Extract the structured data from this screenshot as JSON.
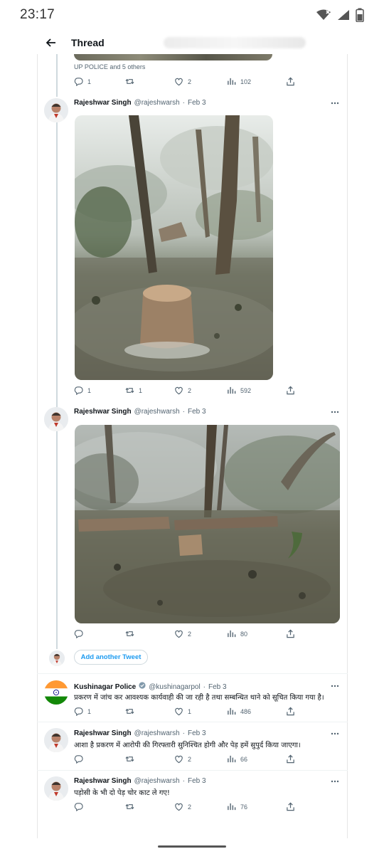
{
  "status_bar": {
    "time": "23:17"
  },
  "header": {
    "title": "Thread"
  },
  "previous_tweet": {
    "context": "UP POLICE and 5 others",
    "replies": "1",
    "retweets": "",
    "likes": "2",
    "views": "102"
  },
  "tweets": [
    {
      "name": "Rajeshwar Singh",
      "handle": "@rajeshwarsh",
      "sep": "·",
      "date": "Feb 3",
      "replies": "1",
      "retweets": "1",
      "likes": "2",
      "views": "592"
    },
    {
      "name": "Rajeshwar Singh",
      "handle": "@rajeshwarsh",
      "sep": "·",
      "date": "Feb 3",
      "replies": "",
      "retweets": "",
      "likes": "2",
      "views": "80"
    }
  ],
  "compose": {
    "add_label": "Add another Tweet"
  },
  "replies": [
    {
      "name": "Kushinagar Police",
      "handle": "@kushinagarpol",
      "sep": "·",
      "date": "Feb 3",
      "text": "प्रकरण में जांच कर आवश्यक कार्यवाही की जा रही है तथा सम्बन्धित थाने को सूचित किया गया है।",
      "replies": "1",
      "retweets": "",
      "likes": "1",
      "views": "486"
    },
    {
      "name": "Rajeshwar Singh",
      "handle": "@rajeshwarsh",
      "sep": "·",
      "date": "Feb 3",
      "text": "आशा है प्रकरण में आरोपी की गिरफ्तारी सुनिश्चित होगी और पेड़ हमें सुपुर्द किया जाएगा।",
      "replies": "",
      "retweets": "",
      "likes": "2",
      "views": "66"
    },
    {
      "name": "Rajeshwar Singh",
      "handle": "@rajeshwarsh",
      "sep": "·",
      "date": "Feb 3",
      "text": "पड़ोसी के भी दो पेड़ चोर काट ले गए!",
      "replies": "",
      "retweets": "",
      "likes": "2",
      "views": "76"
    }
  ],
  "colors": {
    "accent": "#1d9bf0",
    "text": "#0f1419",
    "muted": "#536471",
    "thread_line": "#cfd9de"
  }
}
